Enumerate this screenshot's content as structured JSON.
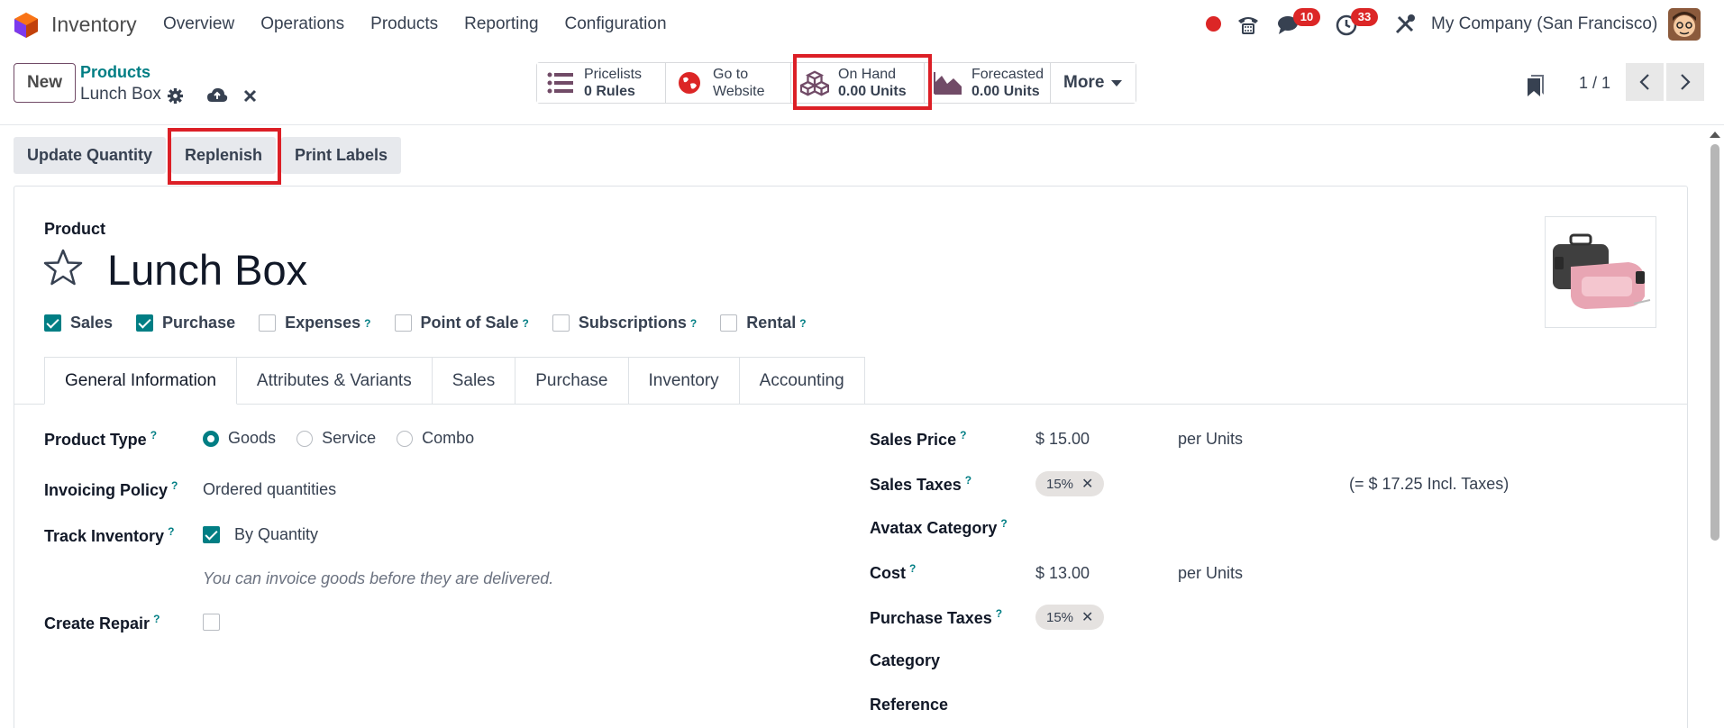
{
  "navbar": {
    "app_name": "Inventory",
    "menu": [
      "Overview",
      "Operations",
      "Products",
      "Reporting",
      "Configuration"
    ],
    "messages_badge": "10",
    "activities_badge": "33",
    "company": "My Company (San Francisco)"
  },
  "control": {
    "new_label": "New",
    "breadcrumb_parent": "Products",
    "breadcrumb_current": "Lunch Box",
    "smart_buttons": {
      "pricelists_l1": "Pricelists",
      "pricelists_l2": "0  Rules",
      "website_l1": "Go to",
      "website_l2": "Website",
      "onhand_l1": "On Hand",
      "onhand_l2": "0.00 Units",
      "forecast_l1": "Forecasted",
      "forecast_l2": "0.00 Units",
      "more": "More"
    },
    "pager": "1 / 1"
  },
  "statusbar": [
    "Update Quantity",
    "Replenish",
    "Print Labels"
  ],
  "form": {
    "product_label": "Product",
    "title": "Lunch Box",
    "checkboxes": [
      {
        "label": "Sales",
        "checked": true,
        "help": false
      },
      {
        "label": "Purchase",
        "checked": true,
        "help": false
      },
      {
        "label": "Expenses",
        "checked": false,
        "help": true
      },
      {
        "label": "Point of Sale",
        "checked": false,
        "help": true
      },
      {
        "label": "Subscriptions",
        "checked": false,
        "help": true
      },
      {
        "label": "Rental",
        "checked": false,
        "help": true
      }
    ],
    "tabs": [
      "General Information",
      "Attributes & Variants",
      "Sales",
      "Purchase",
      "Inventory",
      "Accounting"
    ],
    "left": {
      "product_type_label": "Product Type",
      "types": [
        "Goods",
        "Service",
        "Combo"
      ],
      "invoicing_label": "Invoicing Policy",
      "invoicing_value": "Ordered quantities",
      "track_label": "Track Inventory",
      "track_value": "By Quantity",
      "hint": "You can invoice goods before they are delivered.",
      "repair_label": "Create Repair"
    },
    "right": {
      "sales_price_label": "Sales Price",
      "sales_price_value": "$ 15.00",
      "sales_price_unit": "per Units",
      "sales_taxes_label": "Sales Taxes",
      "sales_tax_tag": "15%",
      "incl_taxes": "(= $ 17.25 Incl. Taxes)",
      "avatax_label": "Avatax Category",
      "cost_label": "Cost",
      "cost_value": "$ 13.00",
      "cost_unit": "per Units",
      "purchase_taxes_label": "Purchase Taxes",
      "purchase_tax_tag": "15%",
      "category_label": "Category",
      "reference_label": "Reference"
    },
    "help_mark": "?"
  },
  "colors": {
    "accent": "#017e84",
    "brand": "#714b67",
    "highlight": "#dc1f26"
  }
}
